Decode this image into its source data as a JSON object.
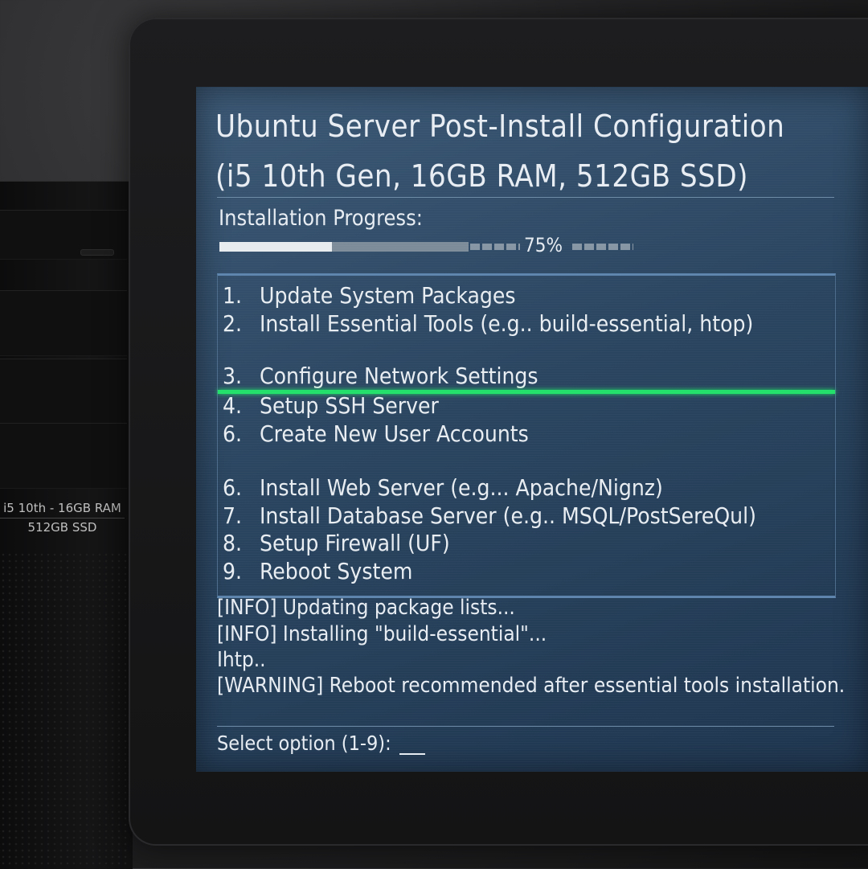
{
  "tower": {
    "label_line1": "i5 10th - 16GB RAM",
    "label_line2": "512GB SSD"
  },
  "terminal": {
    "title_line1": "Ubuntu Server Post-Install Configuration",
    "title_line2": "(i5 10th Gen, 16GB RAM, 512GB SSD)",
    "progress_label": "Installation Progress:",
    "progress_value": 0.75,
    "progress_text": "75%",
    "menu": [
      {
        "num": "1.",
        "label": "Update System Packages"
      },
      {
        "num": "2.",
        "label": "Install Essential Tools (e.g.. build-essential, htop)"
      },
      {
        "num": "3.",
        "label": "Configure Network Settings",
        "selected": true
      },
      {
        "num": "4.",
        "label": "Setup SSH Server"
      },
      {
        "num": "6.",
        "label": "Create New User Accounts"
      },
      {
        "num": "6.",
        "label": "Install Web Server (e.g... Apache/Nignz)"
      },
      {
        "num": "7.",
        "label": "Install Database Server (e.g.. MSQL/PostSereQul)"
      },
      {
        "num": "8.",
        "label": "Setup Firewall (UF)"
      },
      {
        "num": "9.",
        "label": "Reboot System"
      }
    ],
    "log": [
      "[INFO] Updating package lists...",
      "[INFO] Installing \"build-essential\"...",
      "Ihtp..",
      "[WARNING] Reboot recommended after essential tools installation."
    ],
    "prompt": "Select option (1-9):"
  },
  "colors": {
    "screen_bg": "#2a4560",
    "selection_bar": "#22e06a",
    "text": "#e6ecf2"
  }
}
